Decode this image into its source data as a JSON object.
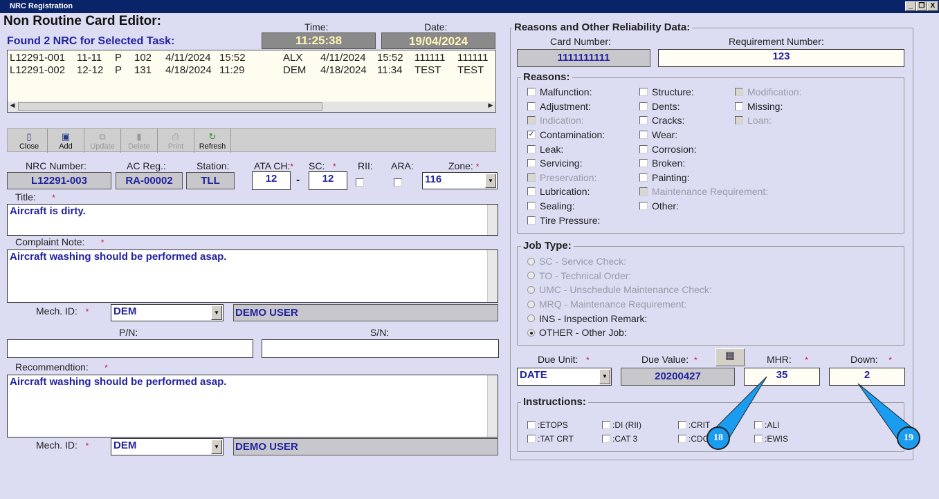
{
  "window": {
    "title": "NRC Registration",
    "minimize": "_",
    "restore": "❐",
    "close": "X"
  },
  "editor": {
    "title": "Non Routine Card Editor:",
    "time_label": "Time:",
    "time": "11:25:38",
    "date_label": "Date:",
    "date": "19/04/2024"
  },
  "nrc_list": {
    "heading": "Found 2 NRC for Selected Task:",
    "rows": [
      [
        "L12291-001",
        "11-11",
        "P",
        "102",
        "4/11/2024",
        "15:52",
        "ALX",
        "4/11/2024",
        "15:52",
        "111111",
        "111111"
      ],
      [
        "L12291-002",
        "12-12",
        "P",
        "131",
        "4/18/2024",
        "11:29",
        "DEM",
        "4/18/2024",
        "11:34",
        "TEST",
        "TEST"
      ]
    ]
  },
  "toolbar": {
    "buttons": [
      {
        "label": "Close",
        "enabled": true
      },
      {
        "label": "Add",
        "enabled": true
      },
      {
        "label": "Update",
        "enabled": false
      },
      {
        "label": "Delete",
        "enabled": false
      },
      {
        "label": "Print",
        "enabled": false
      },
      {
        "label": "Refresh",
        "enabled": true
      }
    ]
  },
  "fields": {
    "nrc_number_label": "NRC Number:",
    "nrc_number": "L12291-003",
    "ac_reg_label": "AC Reg.:",
    "ac_reg": "RA-00002",
    "station_label": "Station:",
    "station": "TLL",
    "ata_label": "ATA CH:",
    "ata": "12",
    "sc_label": "SC:",
    "sc": "12",
    "rii_label": "RII:",
    "ara_label": "ARA:",
    "zone_label": "Zone:",
    "zone": "116",
    "title_label": "Title:",
    "title": "Aircraft is dirty.",
    "complaint_label": "Complaint Note:",
    "complaint": "Aircraft washing should be performed asap.",
    "mech_label": "Mech. ID:",
    "mech_id": "DEM",
    "mech_name": "DEMO USER",
    "pn_label": "P/N:",
    "pn": "",
    "sn_label": "S/N:",
    "sn": "",
    "recommendation_label": "Recommendtion:",
    "recommendation": "Aircraft washing should be performed asap.",
    "mech2_id": "DEM",
    "mech2_name": "DEMO USER",
    "required_mark": "*"
  },
  "reliability": {
    "title": "Reasons and Other Reliability Data:",
    "card_number_label": "Card Number:",
    "card_number": "1111111111",
    "req_number_label": "Requirement Number:",
    "req_number": "123",
    "reasons_title": "Reasons:",
    "reasons": [
      [
        {
          "label": "Malfunction:",
          "checked": false,
          "enabled": true
        },
        {
          "label": "Adjustment:",
          "checked": false,
          "enabled": true
        },
        {
          "label": "Indication:",
          "checked": false,
          "enabled": false
        },
        {
          "label": "Contamination:",
          "checked": true,
          "enabled": true
        },
        {
          "label": "Leak:",
          "checked": false,
          "enabled": true
        },
        {
          "label": "Servicing:",
          "checked": false,
          "enabled": true
        },
        {
          "label": "Preservation:",
          "checked": false,
          "enabled": false
        },
        {
          "label": "Lubrication:",
          "checked": false,
          "enabled": true
        },
        {
          "label": "Sealing:",
          "checked": false,
          "enabled": true
        },
        {
          "label": "Tire Pressure:",
          "checked": false,
          "enabled": true
        }
      ],
      [
        {
          "label": "Structure:",
          "checked": false,
          "enabled": true
        },
        {
          "label": "Dents:",
          "checked": false,
          "enabled": true
        },
        {
          "label": "Cracks:",
          "checked": false,
          "enabled": true
        },
        {
          "label": "Wear:",
          "checked": false,
          "enabled": true
        },
        {
          "label": "Corrosion:",
          "checked": false,
          "enabled": true
        },
        {
          "label": "Broken:",
          "checked": false,
          "enabled": true
        },
        {
          "label": "Painting:",
          "checked": false,
          "enabled": true
        },
        {
          "label": "Maintenance Requirement:",
          "checked": false,
          "enabled": false
        },
        {
          "label": "Other:",
          "checked": false,
          "enabled": true
        }
      ],
      [
        {
          "label": "Modification:",
          "checked": false,
          "enabled": false
        },
        {
          "label": "Missing:",
          "checked": false,
          "enabled": true
        },
        {
          "label": "Loan:",
          "checked": false,
          "enabled": false
        }
      ]
    ],
    "job_type_title": "Job Type:",
    "job_types": [
      {
        "label": "SC - Service Check:",
        "enabled": false,
        "selected": false
      },
      {
        "label": "TO - Technical Order:",
        "enabled": false,
        "selected": false
      },
      {
        "label": "UMC - Unschedule Maintenance Check:",
        "enabled": false,
        "selected": false
      },
      {
        "label": "MRQ - Maintenance Requirement:",
        "enabled": false,
        "selected": false
      },
      {
        "label": "INS - Inspection Remark:",
        "enabled": true,
        "selected": false
      },
      {
        "label": "OTHER - Other Job:",
        "enabled": true,
        "selected": true
      }
    ],
    "due_unit_label": "Due Unit:",
    "due_unit": "DATE",
    "due_value_label": "Due Value:",
    "due_value": "20200427",
    "mhr_label": "MHR:",
    "mhr": "35",
    "down_label": "Down:",
    "down": "2",
    "instructions_title": "Instructions:",
    "instructions": [
      ":ETOPS",
      ":DI (RII)",
      ":CRIT",
      ":ALI",
      ":TAT CRT",
      ":CAT 3",
      ":CDC",
      ":EWIS"
    ]
  },
  "callouts": [
    "18",
    "19"
  ],
  "colors": {
    "titlebar": "#0a246a",
    "value_text": "#2222a0",
    "callout": "#1a9cf0",
    "required": "#d0103a"
  }
}
